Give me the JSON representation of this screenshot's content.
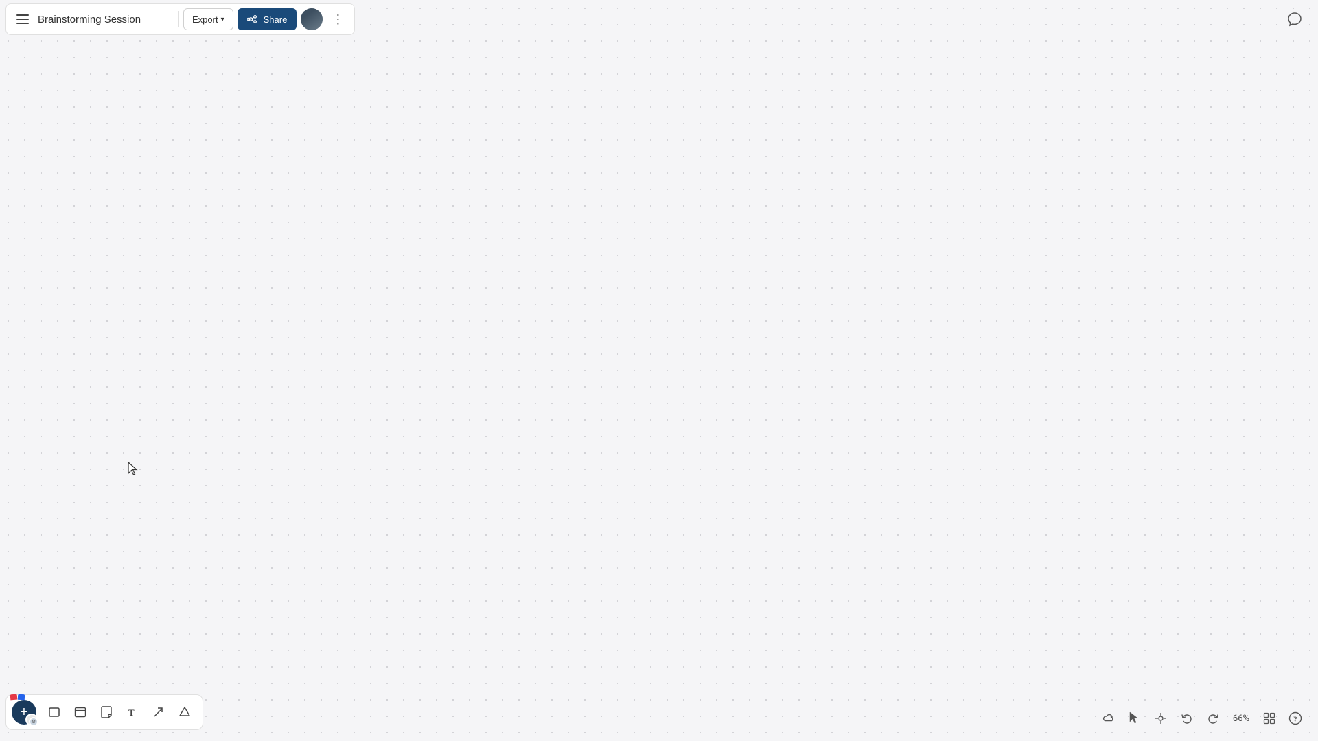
{
  "header": {
    "title": "Brainstorming Session",
    "export_label": "Export",
    "share_label": "Share",
    "more_dots": "⋮"
  },
  "toolbar": {
    "add_label": "+",
    "tools": [
      {
        "name": "rectangle",
        "icon": "□",
        "label": "Rectangle"
      },
      {
        "name": "card",
        "icon": "▭",
        "label": "Card"
      },
      {
        "name": "sticky-note",
        "icon": "⬜",
        "label": "Sticky Note"
      },
      {
        "name": "text",
        "icon": "T",
        "label": "Text"
      },
      {
        "name": "line",
        "icon": "↗",
        "label": "Line/Arrow"
      },
      {
        "name": "pen",
        "icon": "△",
        "label": "Pen/Draw"
      }
    ]
  },
  "bottom_right": {
    "cloud_label": "Cloud",
    "pointer_label": "Pointer",
    "crosshair_label": "Fit to screen",
    "undo_label": "Undo",
    "redo_label": "Redo",
    "zoom": "66%",
    "grid_label": "Grid",
    "help_label": "Help"
  },
  "canvas": {
    "background_color": "#f5f5f7"
  }
}
